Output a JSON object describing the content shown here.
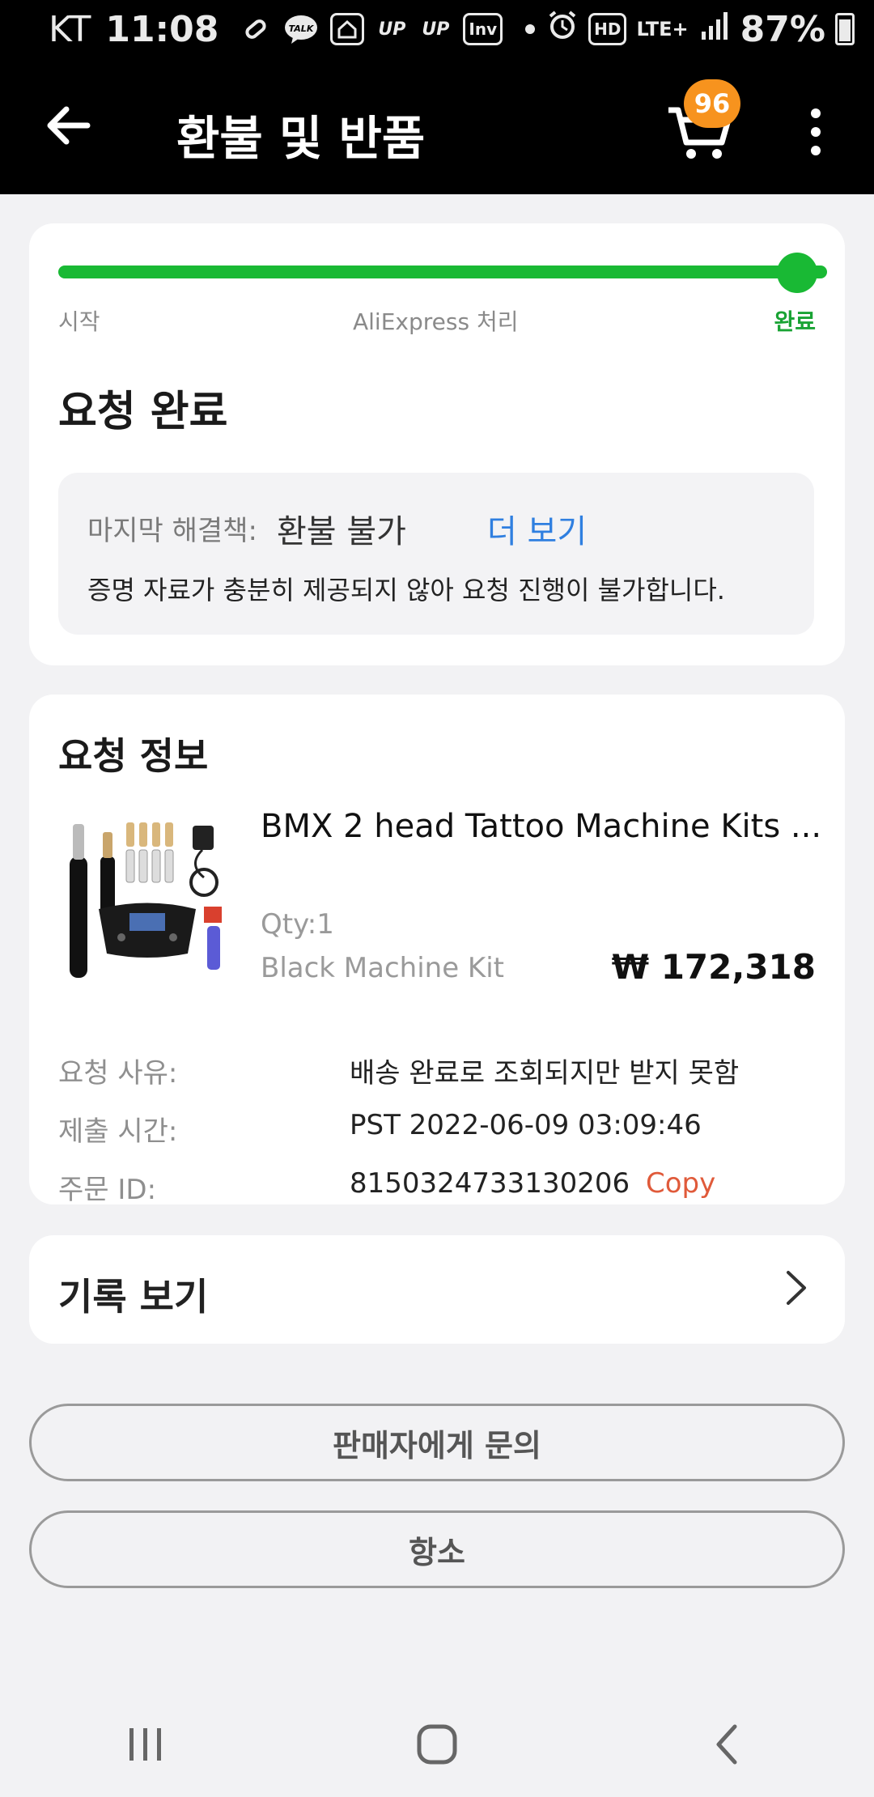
{
  "status_bar": {
    "carrier": "KT",
    "time": "11:08",
    "left_icons": [
      "pill-icon",
      "talk-icon",
      "home-icon",
      "up-icon",
      "up-icon",
      "inv-icon",
      "dot-icon"
    ],
    "talk_text": "TALK",
    "up_text": "UP",
    "inv_text": "Inv",
    "network_text": "LTE+",
    "hd_text": "HD",
    "battery": "87%"
  },
  "header": {
    "title": "환불 및 반품",
    "cart_count": "96"
  },
  "progress": {
    "steps": [
      "시작",
      "AliExpress 처리",
      "완료"
    ],
    "current_step": 3,
    "total_steps": 3,
    "color": "#19b934"
  },
  "status": {
    "title": "요청 완료",
    "resolution_label": "마지막 해결책:",
    "resolution_value": "환불 불가",
    "more_link": "더 보기",
    "description": "증명 자료가 충분히 제공되지 않아 요청 진행이 불가합니다."
  },
  "request_info": {
    "title": "요청 정보",
    "product": {
      "name": "BMX 2 head Tattoo Machine Kits ...",
      "qty": "Qty:1",
      "variant": "Black Machine Kit",
      "price": "₩ 172,318"
    },
    "rows": [
      {
        "label": "요청 사유:",
        "value": "배송 완료로 조회되지만 받지 못함"
      },
      {
        "label": "제출 시간:",
        "value": "PST 2022-06-09 03:09:46"
      },
      {
        "label": "주문 ID:",
        "value": "8150324733130206"
      }
    ],
    "copy_label": "Copy"
  },
  "history": {
    "label": "기록 보기"
  },
  "buttons": {
    "contact_seller": "판매자에게 문의",
    "appeal": "항소"
  },
  "colors": {
    "accent_green": "#19b934",
    "link_blue": "#2f7fe0",
    "copy_red": "#e05a3a",
    "badge_orange": "#f7931e"
  }
}
